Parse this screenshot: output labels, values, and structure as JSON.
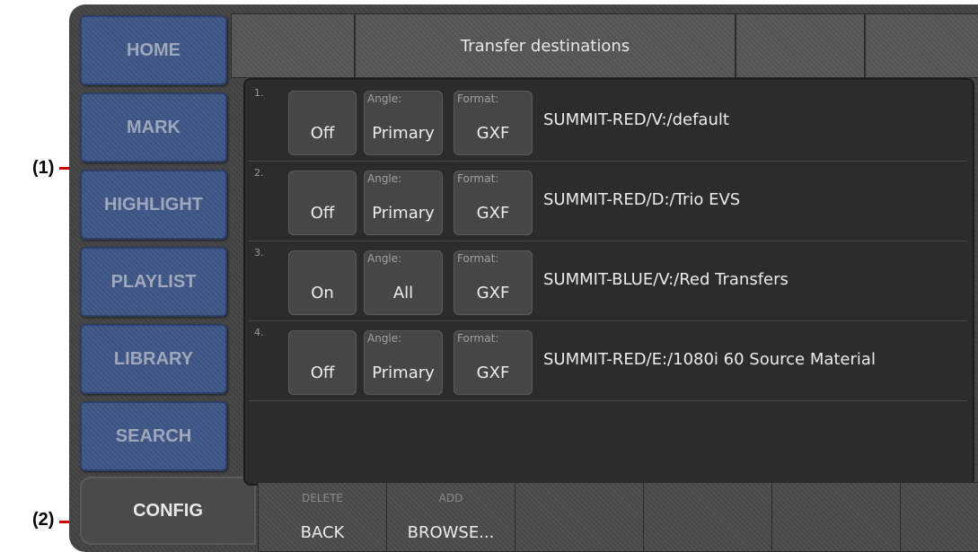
{
  "callouts": [
    "(1)",
    "(2)"
  ],
  "nav": [
    "HOME",
    "MARK",
    "HIGHLIGHT",
    "PLAYLIST",
    "LIBRARY",
    "SEARCH"
  ],
  "config_label": "CONFIG",
  "header": {
    "title": "Transfer destinations"
  },
  "rows": [
    {
      "num": "1.",
      "status": "Off",
      "angle_label": "Angle:",
      "angle": "Primary",
      "format_label": "Format:",
      "format": "GXF",
      "destination": "SUMMIT-RED/V:/default"
    },
    {
      "num": "2.",
      "status": "Off",
      "angle_label": "Angle:",
      "angle": "Primary",
      "format_label": "Format:",
      "format": "GXF",
      "destination": "SUMMIT-RED/D:/Trio EVS"
    },
    {
      "num": "3.",
      "status": "On",
      "angle_label": "Angle:",
      "angle": "All",
      "format_label": "Format:",
      "format": "GXF",
      "destination": "SUMMIT-BLUE/V:/Red Transfers"
    },
    {
      "num": "4.",
      "status": "Off",
      "angle_label": "Angle:",
      "angle": "Primary",
      "format_label": "Format:",
      "format": "GXF",
      "destination": "SUMMIT-RED/E:/1080i 60 Source Material"
    }
  ],
  "bottom": {
    "back_secondary": "DELETE",
    "back_label": "BACK",
    "browse_secondary": "ADD",
    "browse_label": "BROWSE..."
  }
}
